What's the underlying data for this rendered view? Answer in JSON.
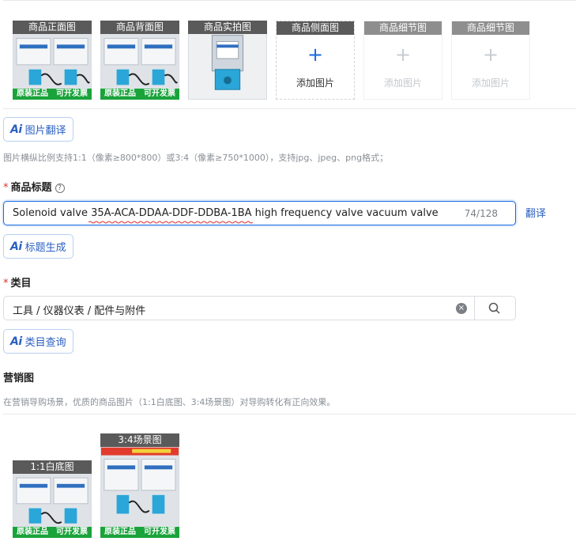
{
  "product_images": {
    "slots": [
      {
        "label": "商品正面图",
        "type": "photo",
        "badges": [
          "原装正品",
          "可开发票"
        ]
      },
      {
        "label": "商品背面图",
        "type": "photo",
        "badges": [
          "原装正品",
          "可开发票"
        ]
      },
      {
        "label": "商品实拍图",
        "type": "photo-single",
        "badges": []
      },
      {
        "label": "商品侧面图",
        "type": "add",
        "add_text": "添加图片",
        "plus": "+",
        "state": "active"
      },
      {
        "label": "商品细节图",
        "type": "add",
        "add_text": "添加图片",
        "plus": "+",
        "state": "disabled"
      },
      {
        "label": "商品细节图",
        "type": "add",
        "add_text": "添加图片",
        "plus": "+",
        "state": "disabled"
      }
    ],
    "ai_button_label": "图片翻译",
    "hint": "图片横纵比例支持1:1（像素≥800*800）或3:4（像素≥750*1000），支持jpg、jpeg、png格式；"
  },
  "ai_icon_text": "Ai",
  "title_field": {
    "required_mark": "*",
    "label": "商品标题",
    "help_icon": "?",
    "value": "Solenoid valve 35A-ACA-DDAA-DDF-DDBA-1BA high frequency valve vacuum valve",
    "counter": "74/128",
    "translate_link": "翻译",
    "ai_button_label": "标题生成"
  },
  "category_field": {
    "required_mark": "*",
    "label": "类目",
    "value": "工具 / 仪器仪表 / 配件与附件",
    "clear_icon": "×",
    "ai_button_label": "类目查询"
  },
  "marketing": {
    "heading": "营销图",
    "hint": "在营销导购场景，优质的商品图片（1:1白底图、3:4场景图）对导购转化有正向效果。",
    "images": [
      {
        "label": "1:1白底图",
        "badges": [
          "原装正品",
          "可开发票"
        ]
      },
      {
        "label": "3:4场景图",
        "badges": [
          "原装正品",
          "可开发票"
        ]
      }
    ]
  },
  "colors": {
    "accent": "#1769e0",
    "ai_blue": "#2a5fc1",
    "required": "#e03030",
    "badge_green": "#1aa33b"
  }
}
